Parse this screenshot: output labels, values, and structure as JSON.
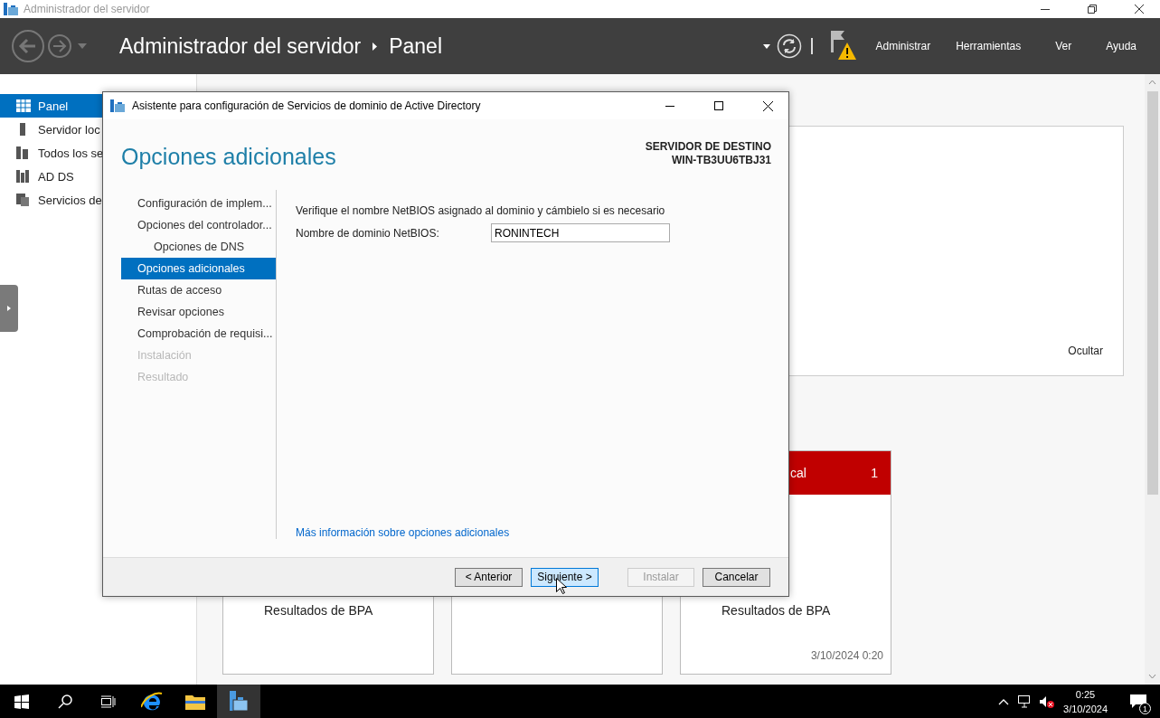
{
  "window": {
    "title": "Administrador del servidor"
  },
  "header": {
    "breadcrumb": [
      "Administrador del servidor",
      "Panel"
    ],
    "menu": [
      "Administrar",
      "Herramientas",
      "Ver",
      "Ayuda"
    ]
  },
  "sidebar": {
    "items": [
      {
        "label": "Panel",
        "selected": true
      },
      {
        "label": "Servidor loc",
        "selected": false
      },
      {
        "label": "Todos los se",
        "selected": false
      },
      {
        "label": "AD DS",
        "selected": false
      },
      {
        "label": "Servicios de",
        "selected": false
      }
    ]
  },
  "content": {
    "hide_link": "Ocultar",
    "tiles": [
      {
        "kind": "plain",
        "bpa": "Resultados de BPA"
      },
      {
        "kind": "plain"
      },
      {
        "kind": "alert",
        "header": "cal",
        "count": "1",
        "bpa": "Resultados de BPA",
        "timestamp": "3/10/2024 0:20"
      }
    ]
  },
  "dialog": {
    "title": "Asistente para configuración de Servicios de dominio de Active Directory",
    "page_title": "Opciones adicionales",
    "target_label": "SERVIDOR DE DESTINO",
    "target_name": "WIN-TB3UU6TBJ31",
    "steps": [
      {
        "label": "Configuración de implem...",
        "selected": false,
        "disabled": false
      },
      {
        "label": "Opciones del controlador...",
        "selected": false,
        "disabled": false,
        "children": [
          {
            "label": "Opciones de DNS",
            "selected": false,
            "disabled": false
          }
        ]
      },
      {
        "label": "Opciones adicionales",
        "selected": true,
        "disabled": false
      },
      {
        "label": "Rutas de acceso",
        "selected": false,
        "disabled": false
      },
      {
        "label": "Revisar opciones",
        "selected": false,
        "disabled": false
      },
      {
        "label": "Comprobación de requisi...",
        "selected": false,
        "disabled": false
      },
      {
        "label": "Instalación",
        "selected": false,
        "disabled": true
      },
      {
        "label": "Resultado",
        "selected": false,
        "disabled": true
      }
    ],
    "description": "Verifique el nombre NetBIOS asignado al dominio y cámbielo si es necesario",
    "field_label": "Nombre de dominio NetBIOS:",
    "field_value": "RONINTECH",
    "link": "Más información sobre opciones adicionales",
    "buttons": [
      {
        "label": "< Anterior",
        "focused": false,
        "disabled": false
      },
      {
        "label": "Siguiente >",
        "focused": true,
        "disabled": false
      },
      {
        "label": "Instalar",
        "focused": false,
        "disabled": true
      },
      {
        "label": "Cancelar",
        "focused": false,
        "disabled": false
      }
    ]
  },
  "taskbar": {
    "time": "0:25",
    "date": "3/10/2024",
    "notifications": "1"
  }
}
